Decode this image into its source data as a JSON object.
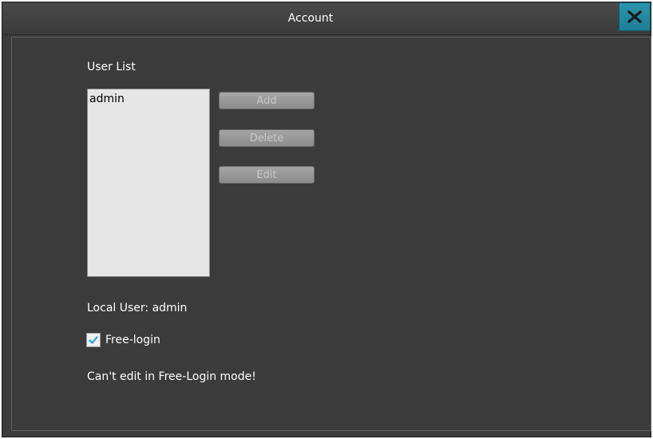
{
  "window": {
    "title": "Account"
  },
  "user_list": {
    "label": "User List",
    "items": [
      "admin"
    ]
  },
  "buttons": {
    "add": "Add",
    "delete": "Delete",
    "edit": "Edit"
  },
  "local_user": {
    "text": "Local User: admin"
  },
  "free_login": {
    "label": "Free-login",
    "checked": true
  },
  "message": "Can't edit in Free-Login mode!",
  "colors": {
    "accent": "#1d7f96",
    "check": "#3aa6d8",
    "window_bg": "#3b3b3b"
  },
  "icons": {
    "close": "close-icon",
    "check": "check-icon"
  }
}
